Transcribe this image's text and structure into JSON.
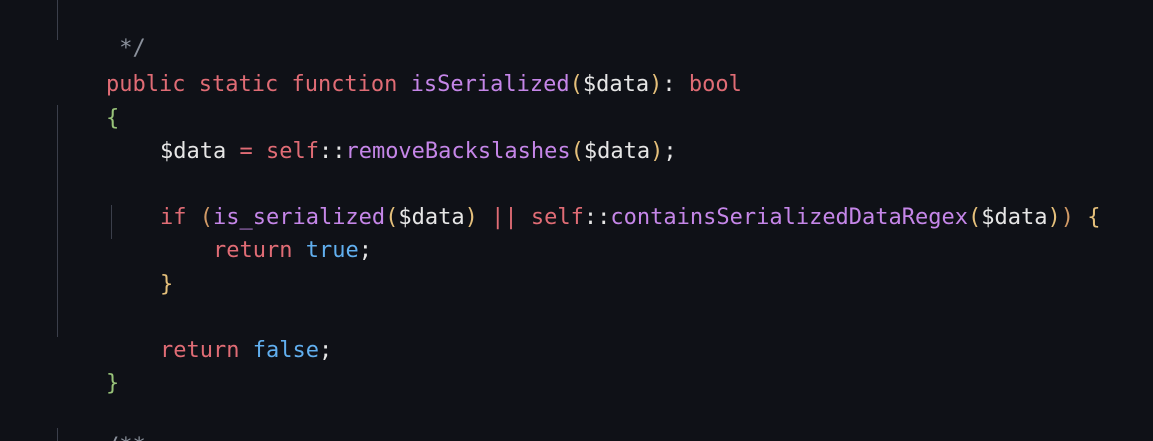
{
  "code": {
    "comment_close": " */",
    "signature": {
      "kw_public": "public",
      "kw_static": "static",
      "kw_function": "function",
      "name": "isSerialized",
      "paren_open": "(",
      "param": "$data",
      "paren_close": ")",
      "colon": ":",
      "ret_type": "bool"
    },
    "brace_open": "{",
    "assign": {
      "var": "$data",
      "eq": "=",
      "self": "self",
      "scope": "::",
      "method": "removeBackslashes",
      "paren_open": "(",
      "arg": "$data",
      "paren_close": ")",
      "semi": ";"
    },
    "if_stmt": {
      "kw_if": "if",
      "paren_open": "(",
      "fn1": "is_serialized",
      "fn1_open": "(",
      "fn1_arg": "$data",
      "fn1_close": ")",
      "or": "||",
      "self": "self",
      "scope": "::",
      "fn2": "containsSerializedDataRegex",
      "fn2_open": "(",
      "fn2_arg": "$data",
      "fn2_close": ")",
      "paren_close": ")",
      "brace": "{"
    },
    "return_true": {
      "kw": "return",
      "value": "true",
      "semi": ";"
    },
    "if_brace_close": "}",
    "return_false": {
      "kw": "return",
      "value": "false",
      "semi": ";"
    },
    "brace_close": "}",
    "doc_open": "/**"
  }
}
